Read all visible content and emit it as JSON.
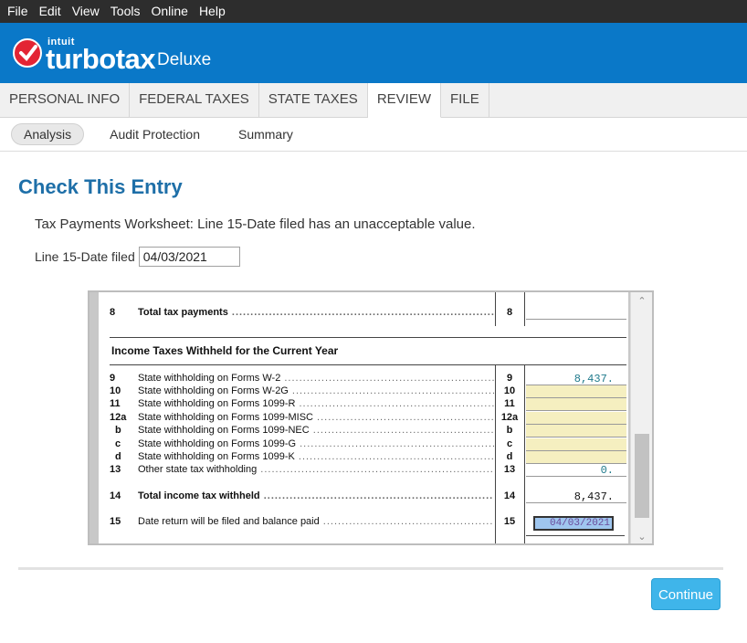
{
  "menu": [
    "File",
    "Edit",
    "View",
    "Tools",
    "Online",
    "Help"
  ],
  "brand": {
    "company": "intuit",
    "product": "turbotax",
    "edition": "Deluxe",
    "accent": "#0a78c8"
  },
  "tabs": [
    {
      "label": "PERSONAL INFO"
    },
    {
      "label": "FEDERAL TAXES"
    },
    {
      "label": "STATE TAXES"
    },
    {
      "label": "REVIEW"
    },
    {
      "label": "FILE"
    }
  ],
  "subnav": [
    {
      "label": "Analysis"
    },
    {
      "label": "Audit Protection"
    },
    {
      "label": "Summary"
    }
  ],
  "page": {
    "title": "Check This Entry",
    "message": "Tax Payments Worksheet: Line 15-Date filed has an unacceptable value.",
    "field_label": "Line 15-Date filed",
    "field_value": "04/03/2021"
  },
  "form": {
    "section_title": "Income Taxes Withheld for the Current Year",
    "top_line": {
      "num": "8",
      "desc": "Total tax payments",
      "ref": "8",
      "value": ""
    },
    "lines": [
      {
        "num": "9",
        "desc": "State withholding on Forms W-2",
        "ref": "9",
        "value": "8,437."
      },
      {
        "num": "10",
        "desc": "State withholding on Forms W-2G",
        "ref": "10",
        "value": ""
      },
      {
        "num": "11",
        "desc": "State withholding on Forms 1099-R",
        "ref": "11",
        "value": ""
      },
      {
        "num": "12a",
        "desc": "State withholding on Forms 1099-MISC",
        "ref": "12a",
        "value": ""
      },
      {
        "num": "b",
        "desc": "State withholding on Forms 1099-NEC",
        "ref": "b",
        "value": ""
      },
      {
        "num": "c",
        "desc": "State withholding on Forms 1099-G",
        "ref": "c",
        "value": ""
      },
      {
        "num": "d",
        "desc": "State withholding on Forms 1099-K",
        "ref": "d",
        "value": ""
      },
      {
        "num": "13",
        "desc": "Other state tax withholding",
        "ref": "13",
        "value": "0."
      },
      {
        "num": "14",
        "desc": "Total income tax withheld",
        "ref": "14",
        "value": "8,437."
      },
      {
        "num": "15",
        "desc": "Date return will be filed and balance paid",
        "ref": "15",
        "value": "04/03/2021"
      }
    ]
  },
  "actions": {
    "continue": "Continue"
  }
}
